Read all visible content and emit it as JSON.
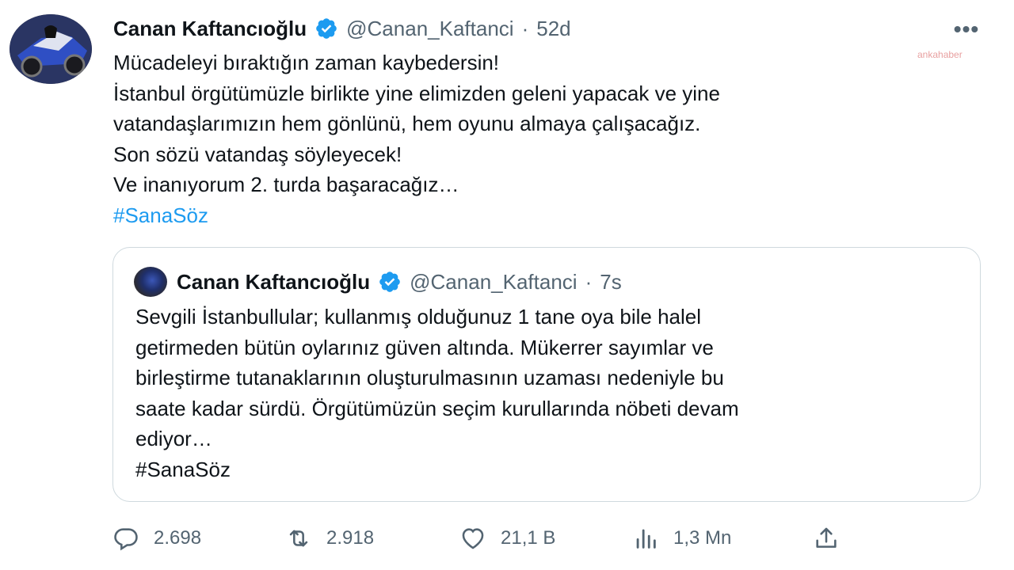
{
  "tweet": {
    "author": {
      "name": "Canan Kaftancıoğlu",
      "handle": "@Canan_Kaftanci",
      "separator": "·",
      "time": "52d"
    },
    "more_label": "•••",
    "watermark": "ankahaber",
    "lines": [
      "Mücadeleyi bıraktığın zaman kaybedersin!",
      "İstanbul örgütümüzle birlikte yine elimizden geleni yapacak ve yine",
      "vatandaşlarımızın hem gönlünü, hem oyunu almaya çalışacağız.",
      "Son sözü vatandaş söyleyecek!",
      "Ve inanıyorum 2. turda başaracağız…"
    ],
    "hashtag": "#SanaSöz"
  },
  "quote": {
    "author": {
      "name": "Canan Kaftancıoğlu",
      "handle": "@Canan_Kaftanci",
      "separator": "·",
      "time": "7s"
    },
    "lines": [
      "Sevgili İstanbullular; kullanmış olduğunuz 1 tane oya bile halel",
      "getirmeden bütün oylarınız güven altında. Mükerrer sayımlar ve",
      "birleştirme tutanaklarının oluşturulmasının uzaması nedeniyle bu",
      "saate kadar sürdü. Örgütümüzün seçim kurullarında nöbeti devam",
      "ediyor…",
      "#SanaSöz"
    ]
  },
  "actions": {
    "reply": {
      "icon": "reply-icon",
      "count": "2.698"
    },
    "retweet": {
      "icon": "retweet-icon",
      "count": "2.918"
    },
    "like": {
      "icon": "heart-icon",
      "count": "21,1 B"
    },
    "views": {
      "icon": "views-icon",
      "count": "1,3 Mn"
    },
    "share": {
      "icon": "share-icon"
    }
  },
  "colors": {
    "text": "#0f1419",
    "secondary": "#536471",
    "accent": "#1d9bf0",
    "border": "#cfd9de"
  }
}
